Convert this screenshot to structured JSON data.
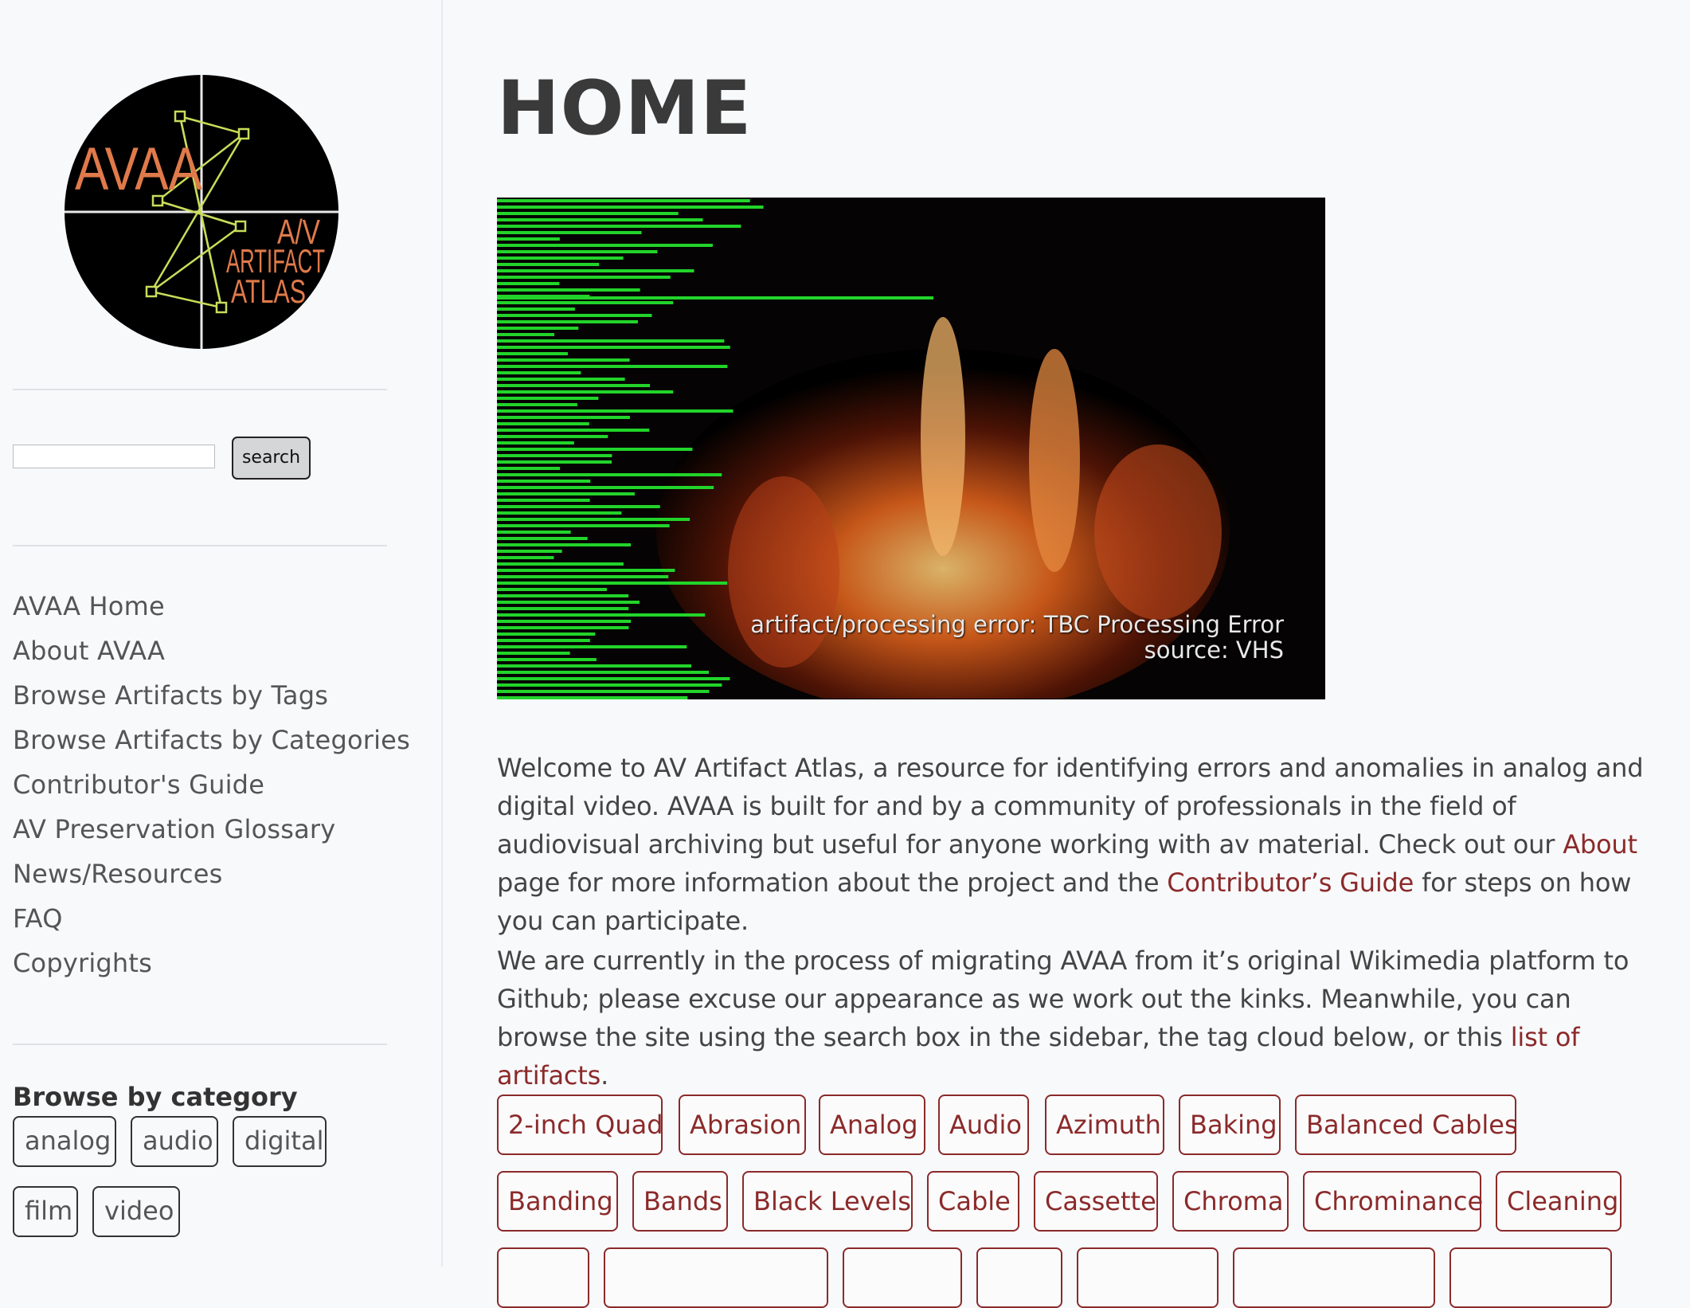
{
  "sidebar": {
    "logo": {
      "title_line": "AVAA",
      "subtitle_lines": [
        "A/V",
        "ARTIFACT",
        "ATLAS"
      ]
    },
    "search": {
      "placeholder": "",
      "button_label": "search"
    },
    "nav": [
      "AVAA Home",
      "About AVAA",
      "Browse Artifacts by Tags",
      "Browse Artifacts by Categories",
      "Contributor's Guide",
      "AV Preservation Glossary",
      "News/Resources",
      "FAQ",
      "Copyrights"
    ],
    "category_heading": "Browse by category",
    "categories": [
      "analog",
      "audio",
      "digital",
      "film",
      "video"
    ]
  },
  "main": {
    "title": "HOME",
    "hero_caption": {
      "line1": "artifact/processing error: TBC Processing Error",
      "line2": "source: VHS"
    },
    "para1": {
      "a": "Welcome to AV Artifact Atlas, a resource for identifying errors and anomalies in analog and digital video. AVAA is built for and by a community of professionals in the field of audiovisual archiving but useful for anyone working with av material. Check out our ",
      "link1": "About",
      "b": " page for more information about the project and the ",
      "link2": "Contributor’s Guide",
      "c": " for steps on how you can participate."
    },
    "para2": {
      "a": "We are currently in the process of migrating AVAA from it’s original Wikimedia platform to Github; please excuse our appearance as we work out the kinks. Meanwhile, you can browse the site using the search box in the sidebar, the tag cloud below, or this ",
      "link": "list of artifacts",
      "b": "."
    },
    "tags_row1": [
      "2-inch Quad",
      "Abrasion",
      "Analog",
      "Audio",
      "Azimuth",
      "Baking",
      "Balanced Cables"
    ],
    "tags_row2": [
      "Banding",
      "Bands",
      "Black Levels",
      "Cable",
      "Cassette",
      "Chroma",
      "Chrominance",
      "Cleaning"
    ]
  },
  "colors": {
    "link": "#8b2a2a",
    "logo_orange": "#e07a4a",
    "logo_lines": "#c9dc5a",
    "glitch_green": "#22d42a"
  }
}
